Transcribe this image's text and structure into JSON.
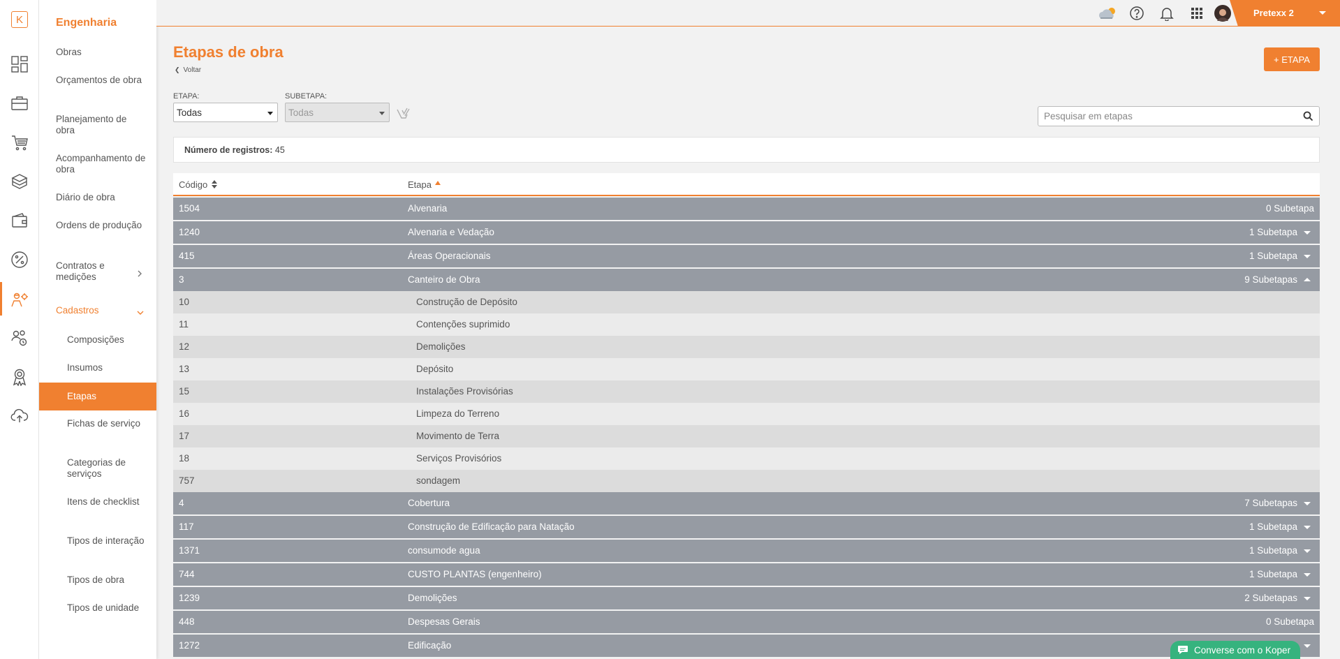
{
  "rail": {
    "logo_letter": "K",
    "icons": [
      "dashboard-icon",
      "briefcase-icon",
      "cart-icon",
      "boxes-icon",
      "wallet-icon",
      "percent-icon",
      "engineer-icon",
      "people-settings-icon",
      "award-icon",
      "cloud-upload-icon"
    ]
  },
  "sidebar": {
    "title": "Engenharia",
    "items": [
      {
        "label": "Obras"
      },
      {
        "label": "Orçamentos de obra"
      },
      {
        "label": "Planejamento de obra"
      },
      {
        "label": "Acompanhamento de obra"
      },
      {
        "label": "Diário de obra"
      },
      {
        "label": "Ordens de produção"
      },
      {
        "label": "Contratos e medições"
      },
      {
        "label": "Cadastros"
      }
    ],
    "sub_items": [
      {
        "label": "Composições"
      },
      {
        "label": "Insumos"
      },
      {
        "label": "Etapas"
      },
      {
        "label": "Fichas de serviço"
      },
      {
        "label": "Categorias de serviços"
      },
      {
        "label": "Itens de checklist"
      },
      {
        "label": "Tipos de interação"
      },
      {
        "label": "Tipos de obra"
      },
      {
        "label": "Tipos de unidade"
      }
    ]
  },
  "topbar": {
    "user_name": "Pretexx 2"
  },
  "page": {
    "title": "Etapas de obra",
    "back_label": "Voltar",
    "add_button": "+ ETAPA"
  },
  "filters": {
    "etapa_label": "ETAPA:",
    "etapa_value": "Todas",
    "subetapa_label": "SUBETAPA:",
    "subetapa_value": "Todas",
    "search_placeholder": "Pesquisar em etapas"
  },
  "records": {
    "label": "Número de registros:",
    "count": "45"
  },
  "table": {
    "col_code": "Código",
    "col_name": "Etapa",
    "rows": [
      {
        "code": "1504",
        "name": "Alvenaria",
        "count": "0 Subetapa",
        "caret": "none"
      },
      {
        "code": "1240",
        "name": "Alvenaria e Vedação",
        "count": "1 Subetapa",
        "caret": "down"
      },
      {
        "code": "415",
        "name": "Áreas Operacionais",
        "count": "1 Subetapa",
        "caret": "down"
      },
      {
        "code": "3",
        "name": "Canteiro de Obra",
        "count": "9 Subetapas",
        "caret": "up"
      },
      {
        "code": "4",
        "name": "Cobertura",
        "count": "7 Subetapas",
        "caret": "down"
      },
      {
        "code": "117",
        "name": "Construção de Edificação para Natação",
        "count": "1 Subetapa",
        "caret": "down"
      },
      {
        "code": "1371",
        "name": "consumode agua",
        "count": "1 Subetapa",
        "caret": "down"
      },
      {
        "code": "744",
        "name": "CUSTO PLANTAS (engenheiro)",
        "count": "1 Subetapa",
        "caret": "down"
      },
      {
        "code": "1239",
        "name": "Demolições",
        "count": "2 Subetapas",
        "caret": "down"
      },
      {
        "code": "448",
        "name": "Despesas Gerais",
        "count": "0 Subetapa",
        "caret": "none"
      },
      {
        "code": "1272",
        "name": "Edificação",
        "count": "",
        "caret": "down"
      }
    ],
    "subrows": [
      {
        "code": "10",
        "name": "Construção de Depósito"
      },
      {
        "code": "11",
        "name": "Contenções suprimido"
      },
      {
        "code": "12",
        "name": "Demolições"
      },
      {
        "code": "13",
        "name": "Depósito"
      },
      {
        "code": "15",
        "name": "Instalações Provisórias"
      },
      {
        "code": "16",
        "name": "Limpeza do Terreno"
      },
      {
        "code": "17",
        "name": "Movimento de Terra"
      },
      {
        "code": "18",
        "name": "Serviços Provisórios"
      },
      {
        "code": "757",
        "name": "sondagem"
      }
    ]
  },
  "chat": {
    "label": "Converse com o Koper"
  },
  "colors": {
    "accent": "#f08030",
    "row_main": "#969ba3",
    "chat": "#36b37e"
  }
}
